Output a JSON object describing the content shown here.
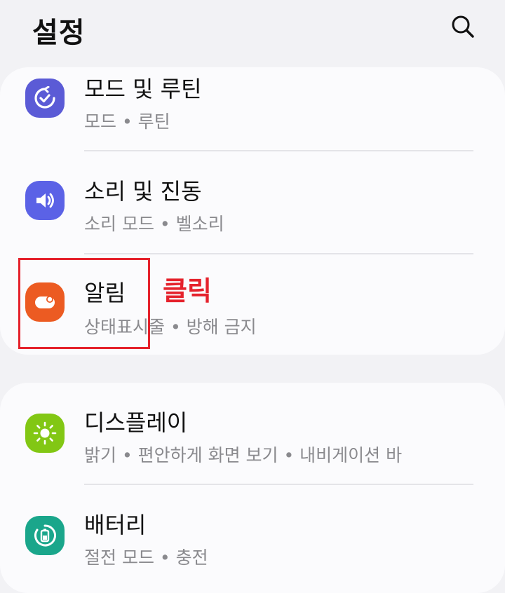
{
  "header": {
    "title": "설정",
    "search_icon": "search-icon"
  },
  "rows": [
    {
      "title": "모드 및 루틴",
      "subtitle": "모드 • 루틴",
      "icon": "modes-routines-icon",
      "icon_color": "#5b5bd6"
    },
    {
      "title": "소리 및 진동",
      "subtitle": "소리 모드 • 벨소리",
      "icon": "sound-icon",
      "icon_color": "#5b62e6"
    },
    {
      "title": "알림",
      "subtitle": "상태표시줄 • 방해 금지",
      "icon": "notification-icon",
      "icon_color": "#ec5b22"
    },
    {
      "title": "디스플레이",
      "subtitle": "밝기 • 편안하게 화면 보기 • 내비게이션 바",
      "icon": "display-brightness-icon",
      "icon_color": "#82c714"
    },
    {
      "title": "배터리",
      "subtitle": "절전 모드 • 충전",
      "icon": "battery-icon",
      "icon_color": "#1aa68b"
    }
  ],
  "annotation": {
    "label": "클릭",
    "color": "#e5222c"
  }
}
